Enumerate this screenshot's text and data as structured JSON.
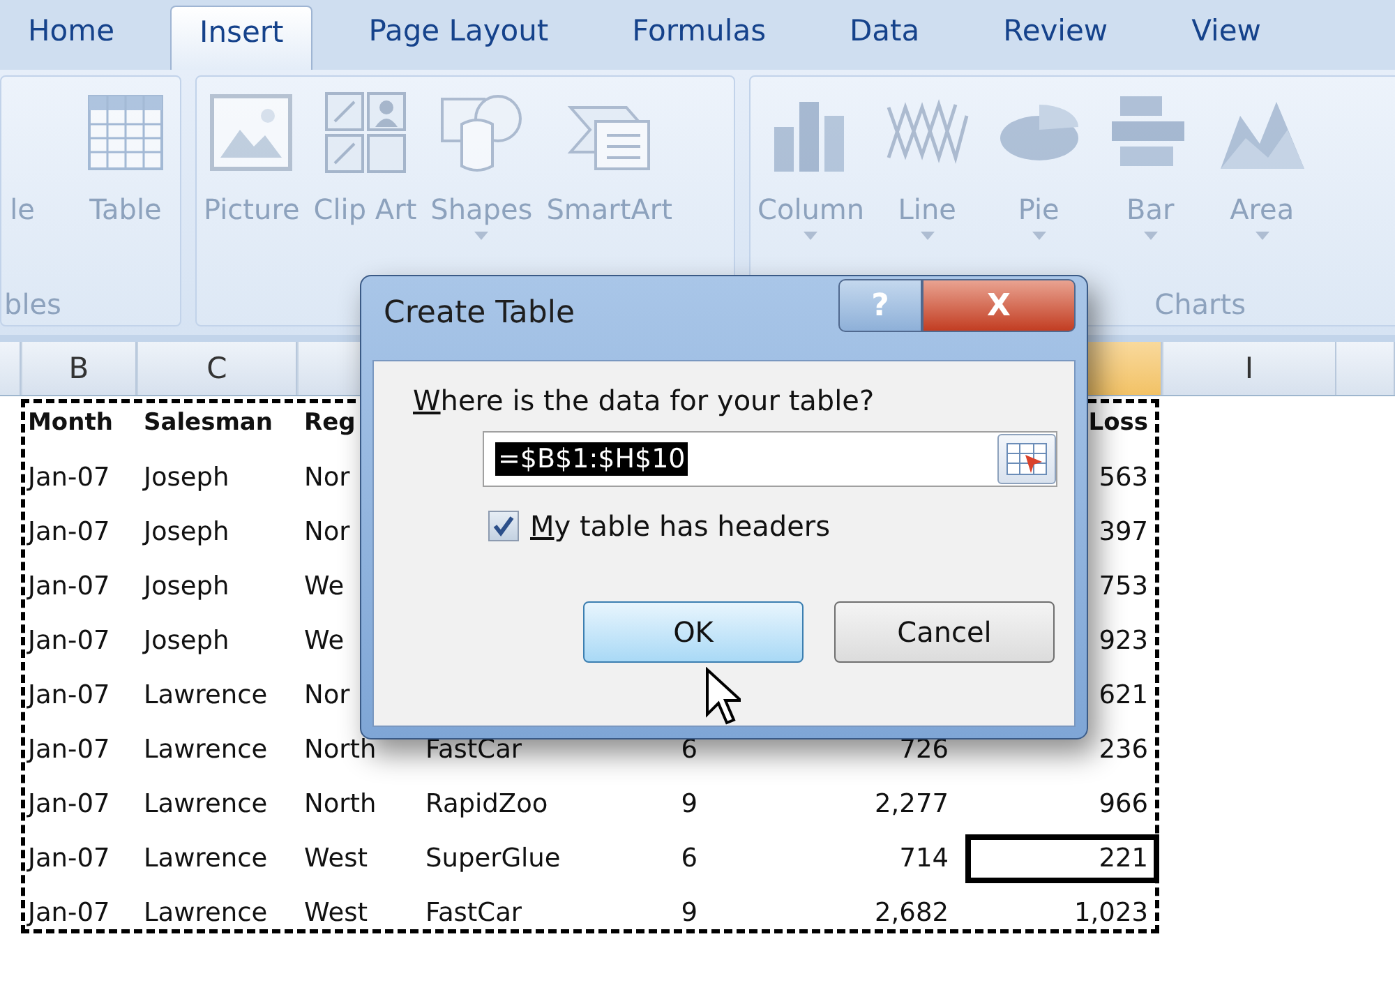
{
  "ribbon": {
    "tabs": [
      {
        "label": "Home",
        "selected": false
      },
      {
        "label": "Insert",
        "selected": true
      },
      {
        "label": "Page Layout",
        "selected": false
      },
      {
        "label": "Formulas",
        "selected": false
      },
      {
        "label": "Data",
        "selected": false
      },
      {
        "label": "Review",
        "selected": false
      },
      {
        "label": "View",
        "selected": false
      }
    ],
    "groups": [
      {
        "label": "bles",
        "items": [
          {
            "label": "le",
            "kind": "partial",
            "has_dropdown": false
          },
          {
            "label": "Table",
            "kind": "table",
            "has_dropdown": false
          }
        ]
      },
      {
        "items": [
          {
            "label": "Picture",
            "kind": "picture",
            "has_dropdown": false
          },
          {
            "label": "Clip Art",
            "kind": "clip-art",
            "has_dropdown": false
          },
          {
            "label": "Shapes",
            "kind": "shapes",
            "has_dropdown": true
          },
          {
            "label": "SmartArt",
            "kind": "smartart",
            "has_dropdown": false
          }
        ]
      },
      {
        "label": "Charts",
        "items": [
          {
            "label": "Column",
            "kind": "column",
            "has_dropdown": true
          },
          {
            "label": "Line",
            "kind": "line",
            "has_dropdown": true
          },
          {
            "label": "Pie",
            "kind": "pie",
            "has_dropdown": true
          },
          {
            "label": "Bar",
            "kind": "bar",
            "has_dropdown": true
          },
          {
            "label": "Area",
            "kind": "area",
            "has_dropdown": true
          }
        ]
      }
    ]
  },
  "sheet": {
    "column_headers": {
      "b": {
        "label": "B",
        "highlighted": false
      },
      "c": {
        "label": "C",
        "highlighted": false
      },
      "d": {
        "highlighted": false
      },
      "h": {
        "highlighted": true
      },
      "i": {
        "label": "I",
        "highlighted": false
      }
    },
    "rows": [
      {
        "kind": "header",
        "b": {
          "text": "Month",
          "selected": false
        },
        "c": {
          "text": "Salesman",
          "selected": false
        },
        "d": {
          "text": "Reg",
          "selected": false
        },
        "h": {
          "text": "Loss",
          "selected": false
        }
      },
      {
        "kind": "data",
        "b": {
          "text": "Jan-07",
          "selected": false
        },
        "c": {
          "text": "Joseph",
          "selected": false
        },
        "d": {
          "text": "Nor",
          "selected": false
        },
        "h": {
          "text": "563",
          "selected": false
        }
      },
      {
        "kind": "data",
        "b": {
          "text": "Jan-07",
          "selected": false
        },
        "c": {
          "text": "Joseph",
          "selected": false
        },
        "d": {
          "text": "Nor",
          "selected": false
        },
        "h": {
          "text": "397",
          "selected": false
        }
      },
      {
        "kind": "data",
        "b": {
          "text": "Jan-07",
          "selected": false
        },
        "c": {
          "text": "Joseph",
          "selected": false
        },
        "d": {
          "text": "We",
          "selected": false
        },
        "h": {
          "text": "753",
          "selected": false
        }
      },
      {
        "kind": "data",
        "b": {
          "text": "Jan-07",
          "selected": false
        },
        "c": {
          "text": "Joseph",
          "selected": false
        },
        "d": {
          "text": "We",
          "selected": false
        },
        "h": {
          "text": "923",
          "selected": false
        }
      },
      {
        "kind": "data",
        "b": {
          "text": "Jan-07",
          "selected": false
        },
        "c": {
          "text": "Lawrence",
          "selected": false
        },
        "d": {
          "text": "Nor",
          "selected": false
        },
        "h": {
          "text": "621",
          "selected": false
        }
      },
      {
        "kind": "data",
        "b": {
          "text": "Jan-07",
          "selected": false
        },
        "c": {
          "text": "Lawrence",
          "selected": false
        },
        "d": {
          "text": "North",
          "selected": false
        },
        "e": {
          "text": "FastCar",
          "selected": false
        },
        "f": {
          "text": "6",
          "selected": false
        },
        "g": {
          "text": "726",
          "selected": false
        },
        "h": {
          "text": "236",
          "selected": false
        }
      },
      {
        "kind": "data",
        "b": {
          "text": "Jan-07",
          "selected": false
        },
        "c": {
          "text": "Lawrence",
          "selected": false
        },
        "d": {
          "text": "North",
          "selected": false
        },
        "e": {
          "text": "RapidZoo",
          "selected": false
        },
        "f": {
          "text": "9",
          "selected": false
        },
        "g": {
          "text": "2,277",
          "selected": false
        },
        "h": {
          "text": "966",
          "selected": false
        }
      },
      {
        "kind": "data",
        "b": {
          "text": "Jan-07",
          "selected": false
        },
        "c": {
          "text": "Lawrence",
          "selected": false
        },
        "d": {
          "text": "West",
          "selected": false
        },
        "e": {
          "text": "SuperGlue",
          "selected": false
        },
        "f": {
          "text": "6",
          "selected": false
        },
        "g": {
          "text": "714",
          "selected": false
        },
        "h": {
          "text": "221",
          "selected": true
        }
      },
      {
        "kind": "data",
        "b": {
          "text": "Jan-07",
          "selected": false
        },
        "c": {
          "text": "Lawrence",
          "selected": false
        },
        "d": {
          "text": "West",
          "selected": false
        },
        "e": {
          "text": "FastCar",
          "selected": false
        },
        "f": {
          "text": "9",
          "selected": false
        },
        "g": {
          "text": "2,682",
          "selected": false
        },
        "h": {
          "text": "1,023",
          "selected": false
        }
      }
    ]
  },
  "dialog": {
    "title": "Create Table",
    "help_button": "?",
    "close_button": "X",
    "prompt": {
      "text": "Where is the data for your table?",
      "underline_first_letter": true
    },
    "range_field": {
      "value": "=$B$1:$H$10",
      "text_selected": true
    },
    "checkbox": {
      "label": "My table has headers",
      "checked": true,
      "underline_first_letter": true
    },
    "buttons": [
      {
        "label": "OK",
        "focused": true
      },
      {
        "label": "Cancel",
        "focused": false
      }
    ]
  }
}
